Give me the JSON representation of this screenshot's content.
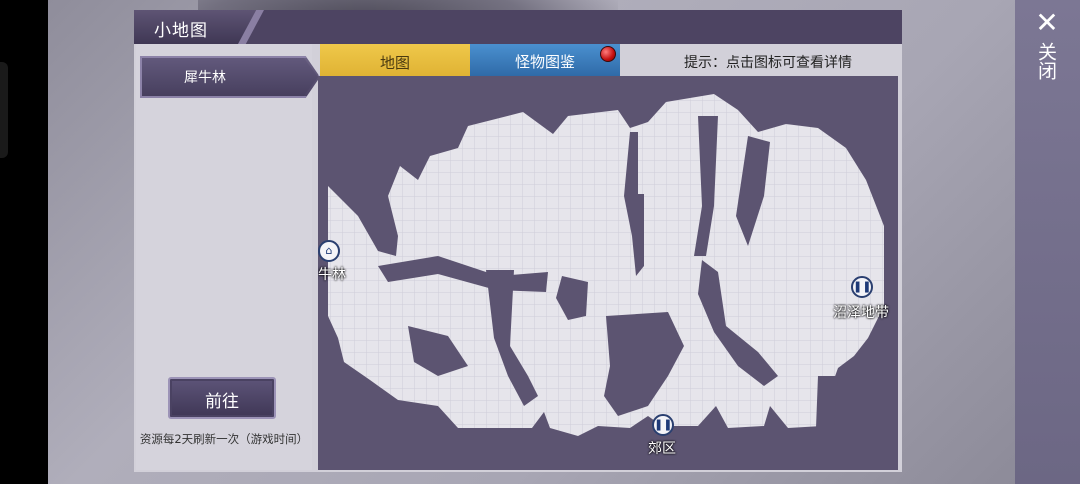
{
  "panel": {
    "title": "小地图"
  },
  "sidebar": {
    "region": "犀牛林",
    "go_button": "前往",
    "refresh_note": "资源每2天刷新一次（游戏时间）"
  },
  "tabs": [
    {
      "label": "地图",
      "active": true,
      "color": "#e8bd3c"
    },
    {
      "label": "怪物图鉴",
      "active": false,
      "color": "#3a7cc0",
      "has_alert": true
    }
  ],
  "hint": "提示：点击图标可查看详情",
  "map": {
    "markers": [
      {
        "label": "犀牛林",
        "icon": "home-icon"
      },
      {
        "label": "沼泽地带",
        "icon": "gate-icon"
      },
      {
        "label": "郊区",
        "icon": "gate-icon"
      }
    ]
  },
  "close": {
    "label": "关闭",
    "icon": "close-x-icon"
  },
  "colors": {
    "panel_bg": "#d2d0d9",
    "map_bg": "#5c5471",
    "accent_purple": "#4d4462",
    "tab_gold": "#e8bd3c",
    "tab_blue": "#3a7cc0"
  }
}
